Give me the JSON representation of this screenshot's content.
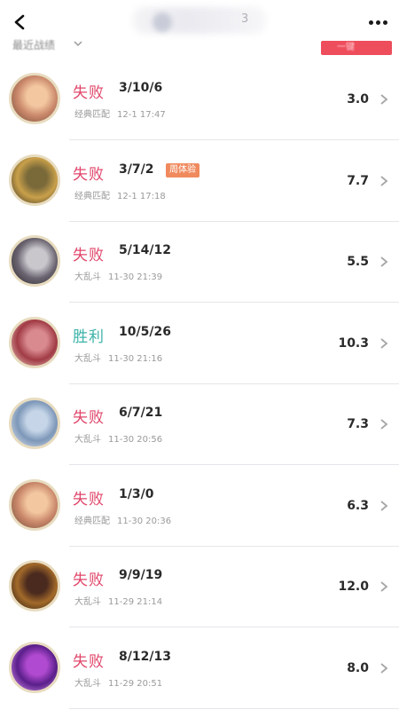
{
  "header": {
    "title_fragment": "3",
    "back_icon": "back-arrow-icon",
    "more_icon": "more-dots-icon"
  },
  "filter": {
    "label": "最近战绩",
    "tab_label": "一键"
  },
  "colors": {
    "defeat": "#e0466a",
    "victory": "#3bb3a9",
    "badge": "#f08a5d"
  },
  "matches": [
    {
      "result": "失败",
      "outcome": "defeat",
      "kda": "3/10/6",
      "badge": "",
      "mode": "经典匹配",
      "time": "12-1 17:47",
      "score": "3.0",
      "avatar_icon": "champion-portrait-blonde-icon",
      "avatar_colors": [
        "#f3c7a0",
        "#c9876a",
        "#6f4a35"
      ]
    },
    {
      "result": "失败",
      "outcome": "defeat",
      "kda": "3/7/2",
      "badge": "周体验",
      "mode": "经典匹配",
      "time": "12-1 17:18",
      "score": "7.7",
      "avatar_icon": "champion-portrait-armored-icon",
      "avatar_colors": [
        "#7a6a3a",
        "#c9a04a",
        "#2e2a1e"
      ]
    },
    {
      "result": "失败",
      "outcome": "defeat",
      "kda": "5/14/12",
      "badge": "",
      "mode": "大乱斗",
      "time": "11-30 21:39",
      "score": "5.5",
      "avatar_icon": "champion-portrait-masked-icon",
      "avatar_colors": [
        "#c9c7cc",
        "#6a6470",
        "#2a2628"
      ]
    },
    {
      "result": "胜利",
      "outcome": "victory",
      "kda": "10/5/26",
      "badge": "",
      "mode": "大乱斗",
      "time": "11-30 21:16",
      "score": "10.3",
      "avatar_icon": "champion-portrait-redhair-icon",
      "avatar_colors": [
        "#d98a8f",
        "#a13b45",
        "#f4dccf"
      ]
    },
    {
      "result": "失败",
      "outcome": "defeat",
      "kda": "6/7/21",
      "badge": "",
      "mode": "大乱斗",
      "time": "11-30 20:56",
      "score": "7.3",
      "avatar_icon": "champion-portrait-silverhair-icon",
      "avatar_colors": [
        "#c6d6e8",
        "#7d97b8",
        "#e9eef5"
      ]
    },
    {
      "result": "失败",
      "outcome": "defeat",
      "kda": "1/3/0",
      "badge": "",
      "mode": "经典匹配",
      "time": "11-30 20:36",
      "score": "6.3",
      "avatar_icon": "champion-portrait-blonde-icon",
      "avatar_colors": [
        "#f3c7a0",
        "#c9876a",
        "#6f4a35"
      ]
    },
    {
      "result": "失败",
      "outcome": "defeat",
      "kda": "9/9/19",
      "badge": "",
      "mode": "大乱斗",
      "time": "11-29 21:14",
      "score": "12.0",
      "avatar_icon": "champion-portrait-dark-icon",
      "avatar_colors": [
        "#4a2a1e",
        "#a36a2a",
        "#1b120e"
      ]
    },
    {
      "result": "失败",
      "outcome": "defeat",
      "kda": "8/12/13",
      "badge": "",
      "mode": "大乱斗",
      "time": "11-29 20:51",
      "score": "8.0",
      "avatar_icon": "champion-portrait-void-icon",
      "avatar_colors": [
        "#b04ad0",
        "#5a1f8a",
        "#e8a0ff"
      ]
    }
  ]
}
